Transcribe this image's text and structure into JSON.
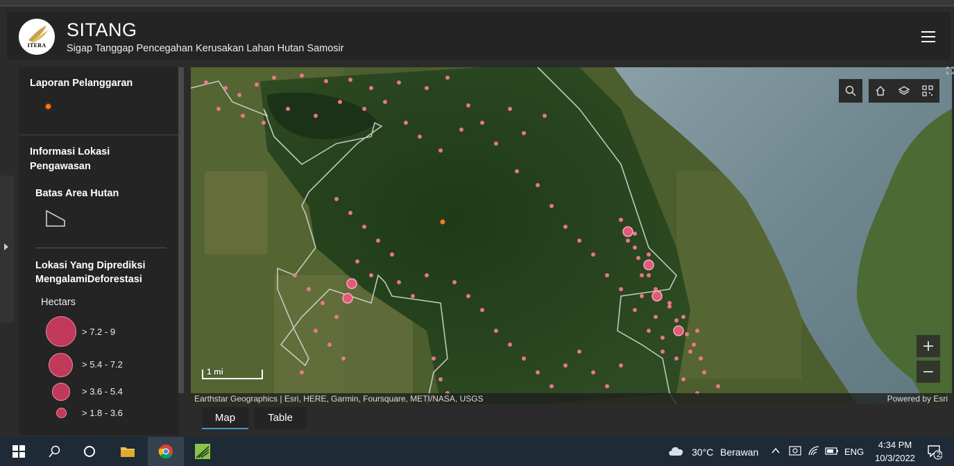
{
  "header": {
    "logo_text": "ITERA",
    "title": "SITANG",
    "subtitle": "Sigap Tanggap Pencegahan Kerusakan Lahan Hutan Samosir",
    "menu_icon": "hamburger-menu-icon"
  },
  "legend": {
    "section1_title": "Laporan Pelanggaran",
    "section2_title": "Informasi Lokasi Pengawasan",
    "section3_title": "Batas Area Hutan",
    "section4_title": "Lokasi Yang Diprediksi MengalamiDeforestasi",
    "units_label": "Hectars",
    "classes": [
      {
        "label": "> 7.2 - 9"
      },
      {
        "label": "> 5.4 - 7.2"
      },
      {
        "label": "> 3.6 - 5.4"
      },
      {
        "label": "> 1.8 - 3.6"
      }
    ],
    "colors": {
      "symbol_fill": "#c0395a",
      "symbol_stroke": "#ee8ea2",
      "fire_dot": "#ff7a1a"
    }
  },
  "map": {
    "scale_label": "1 mi",
    "attribution": "Earthstar Geographics | Esri, HERE, Garmin, Foursquare, METI/NASA, USGS",
    "powered_by": "Powered by Esri",
    "tools": [
      "search-icon",
      "home-icon",
      "layers-icon",
      "qr-code-icon"
    ],
    "zoom_in": "+",
    "zoom_out": "−"
  },
  "tabs": [
    {
      "label": "Map",
      "active": true
    },
    {
      "label": "Table",
      "active": false
    }
  ],
  "taskbar": {
    "weather_temp": "30°C",
    "weather_desc": "Berawan",
    "language": "ENG",
    "time": "4:34 PM",
    "date": "10/3/2022",
    "notification_count": "2"
  }
}
